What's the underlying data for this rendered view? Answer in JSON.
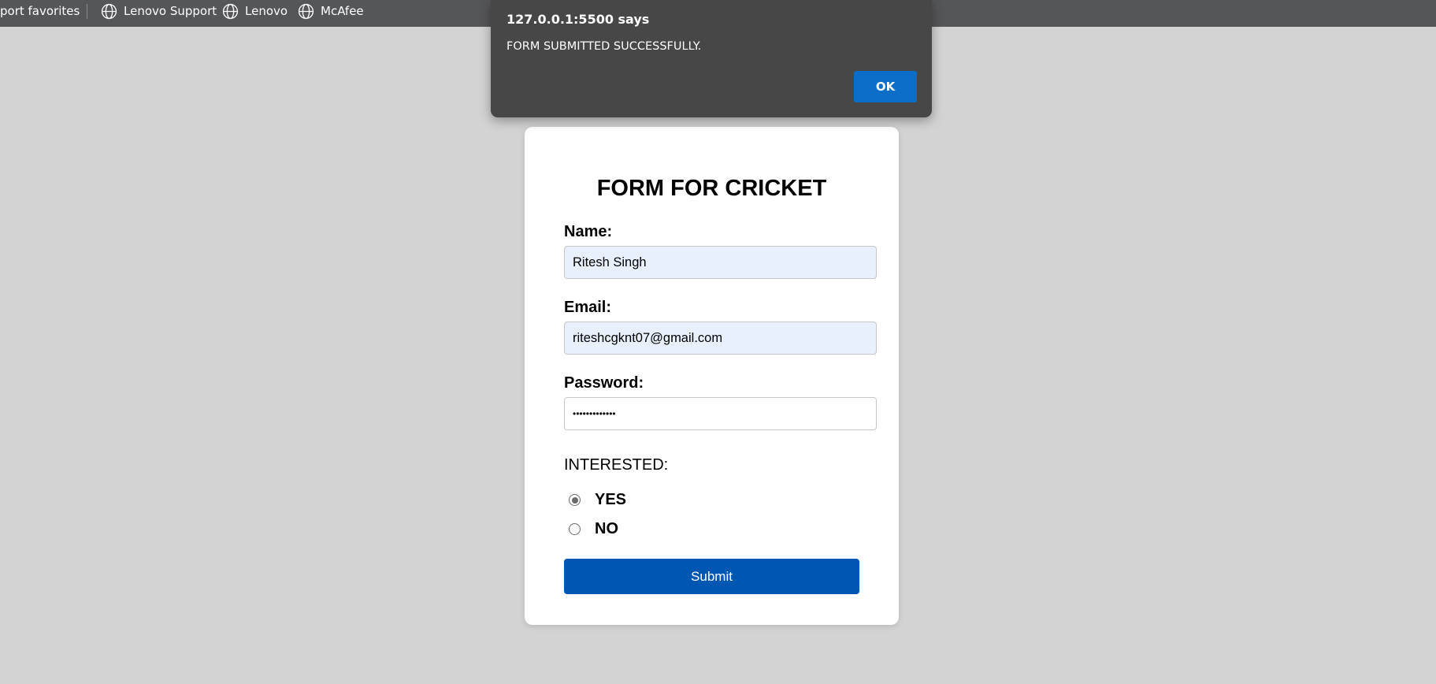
{
  "bookmarks": {
    "items": [
      {
        "label": "port favorites",
        "icon": "none"
      },
      {
        "label": "Lenovo Support",
        "icon": "globe-icon"
      },
      {
        "label": "Lenovo",
        "icon": "globe-icon"
      },
      {
        "label": "McAfee",
        "icon": "globe-icon"
      }
    ]
  },
  "dialog": {
    "title": "127.0.0.1:5500 says",
    "message": "FORM SUBMITTED SUCCESSFULLY.",
    "ok_label": "OK",
    "accent": "#0b6ec9"
  },
  "form": {
    "title": "FORM FOR CRICKET",
    "name_label": "Name:",
    "name_value": "Ritesh Singh",
    "email_label": "Email:",
    "email_value": "riteshcgknt07@gmail.com",
    "password_label": "Password:",
    "password_value": "•••••••••••••",
    "interested_label": "INTERESTED:",
    "options": [
      {
        "label": "YES",
        "checked": true
      },
      {
        "label": "NO",
        "checked": false
      }
    ],
    "submit_label": "Submit",
    "submit_color": "#0056b3"
  }
}
